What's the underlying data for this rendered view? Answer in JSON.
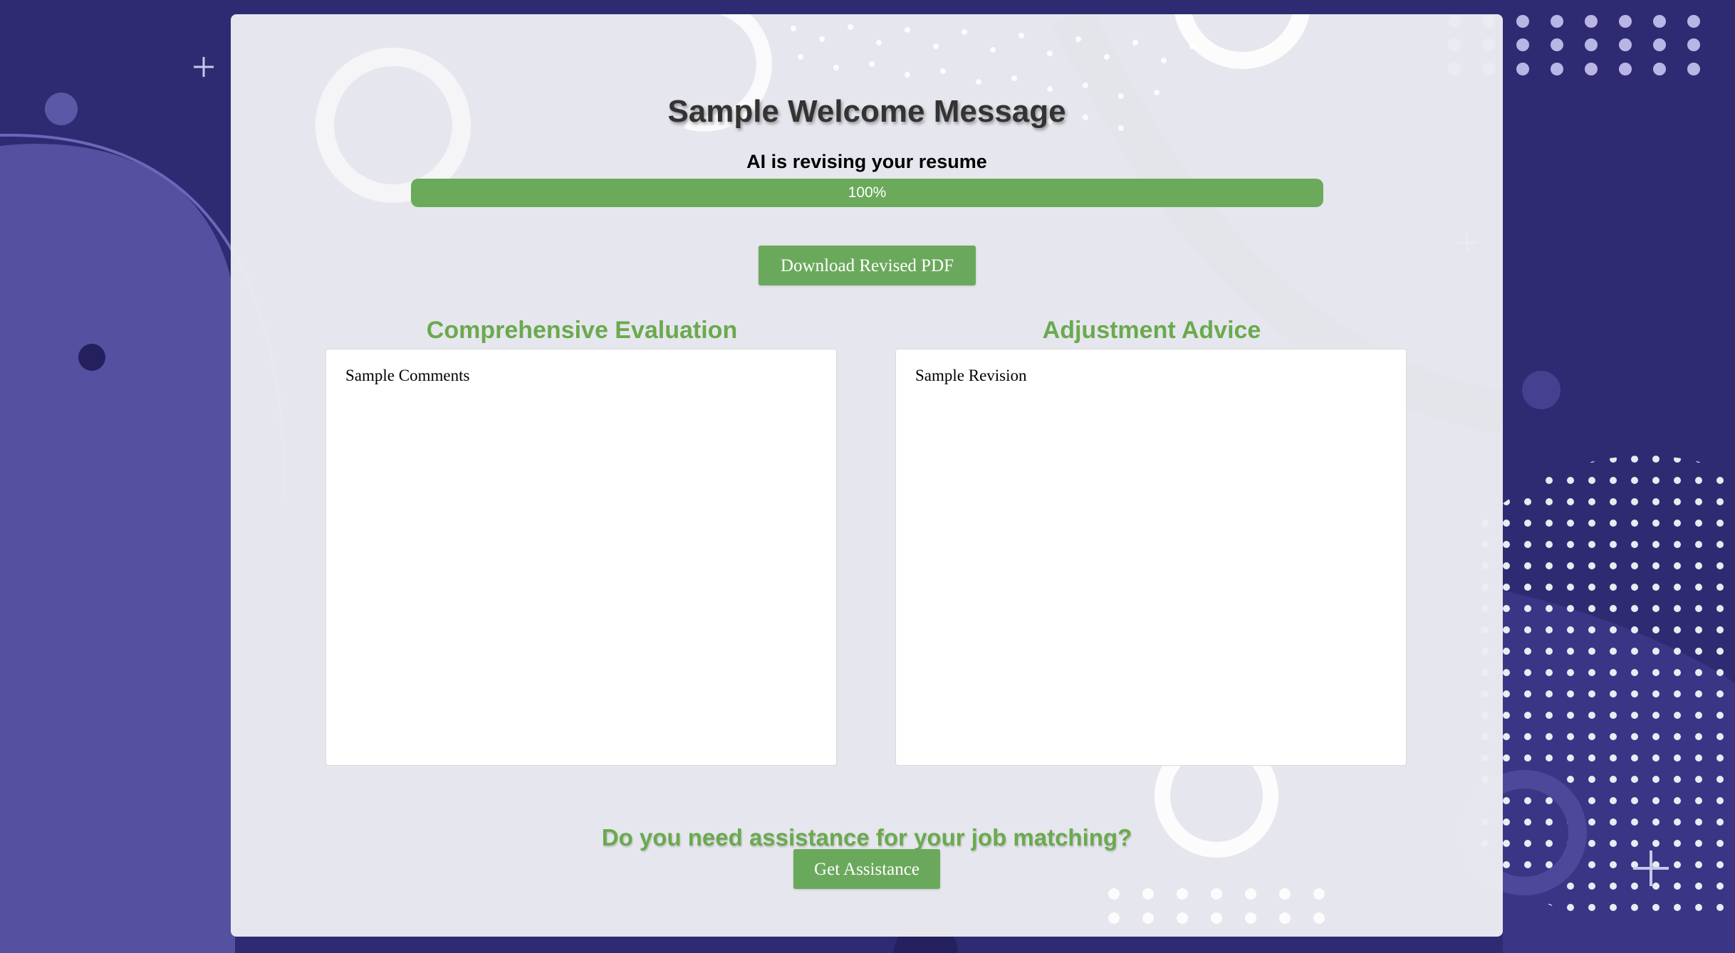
{
  "header": {
    "title": "Sample Welcome Message",
    "subtitle": "AI is revising your resume"
  },
  "progress": {
    "value": 100,
    "label": "100%",
    "color": "#6aaa5a"
  },
  "actions": {
    "download_label": "Download Revised PDF",
    "assist_label": "Get Assistance"
  },
  "evaluation": {
    "title": "Comprehensive Evaluation",
    "content": "Sample Comments"
  },
  "advice": {
    "title": "Adjustment Advice",
    "content": "Sample Revision"
  },
  "assistance": {
    "question": "Do you need assistance for your job matching?"
  },
  "colors": {
    "accent": "#6aaa4d",
    "button": "#6aa95c",
    "background": "#2f2b72",
    "card": "#ececf2"
  }
}
